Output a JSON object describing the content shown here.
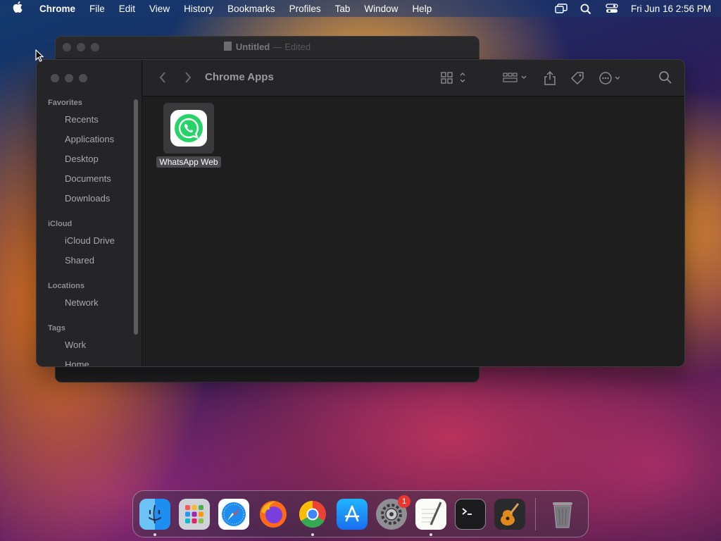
{
  "menubar": {
    "app_name": "Chrome",
    "menus": [
      "File",
      "Edit",
      "View",
      "History",
      "Bookmarks",
      "Profiles",
      "Tab",
      "Window",
      "Help"
    ],
    "clock": "Fri Jun 16  2:56 PM"
  },
  "back_window": {
    "title": "Untitled",
    "separator": "—",
    "status": "Edited"
  },
  "finder": {
    "title": "Chrome Apps",
    "sections": {
      "favorites": "Favorites",
      "icloud": "iCloud",
      "locations": "Locations",
      "tags": "Tags"
    },
    "favorites": [
      "Recents",
      "Applications",
      "Desktop",
      "Documents",
      "Downloads"
    ],
    "icloud_items": [
      "iCloud Drive",
      "Shared"
    ],
    "locations_items": [
      "Network"
    ],
    "tags_items": [
      "Work",
      "Home"
    ],
    "files": [
      {
        "name": "WhatsApp Web",
        "icon": "whatsapp-icon"
      }
    ]
  },
  "dock": {
    "apps": [
      "finder",
      "launchpad",
      "safari",
      "firefox",
      "chrome",
      "app-store",
      "system-settings",
      "textedit",
      "terminal",
      "garageband",
      "trash"
    ],
    "settings_badge": "1"
  },
  "colors": {
    "whatsapp_green": "#25D366",
    "badge_red": "#E8372F"
  }
}
